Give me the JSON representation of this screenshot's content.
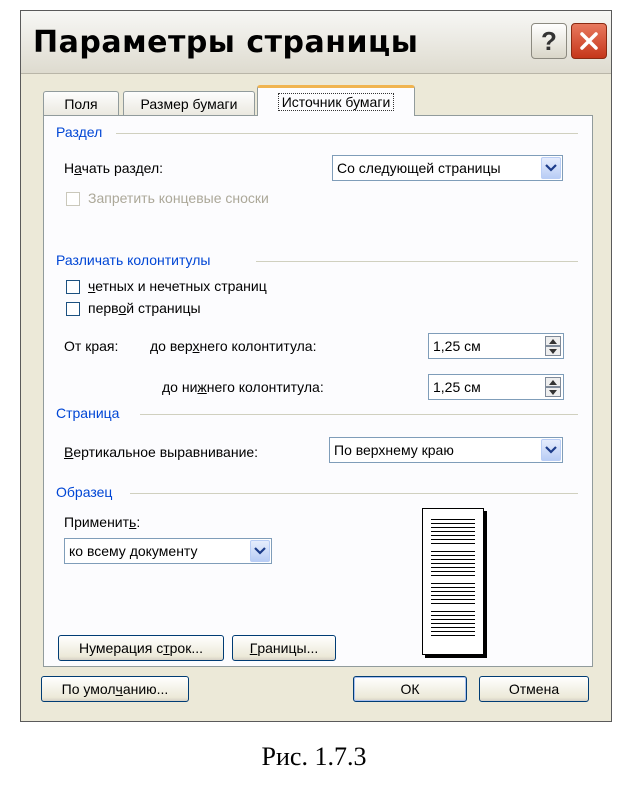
{
  "dialog": {
    "title": "Параметры страницы",
    "help_label": "?",
    "tabs": [
      {
        "label": "Поля",
        "active": false
      },
      {
        "label": "Размер бумаги",
        "active": false
      },
      {
        "label": "Источник бумаги",
        "active": true
      }
    ],
    "section": {
      "title": "Раздел",
      "start_label_pre": "Н",
      "start_label_u": "а",
      "start_label_post": "чать раздел:",
      "start_value": "Со следующей страницы",
      "suppress_endnotes_label": "Запретить концевые сноски",
      "suppress_endnotes_checked": false
    },
    "headers": {
      "title": "Различать колонтитулы",
      "odd_even_u": "ч",
      "odd_even_post": "етных и нечетных страниц",
      "odd_even_checked": false,
      "first_pre": "перв",
      "first_u": "о",
      "first_post": "й страницы",
      "first_checked": false,
      "from_edge_label": "От края:",
      "header_label_pre": "до вер",
      "header_label_u": "х",
      "header_label_post": "него колонтитула:",
      "header_value": "1,25 см",
      "footer_label_pre": "до ни",
      "footer_label_u": "ж",
      "footer_label_post": "него колонтитула:",
      "footer_value": "1,25 см"
    },
    "page": {
      "title": "Страница",
      "valign_u": "В",
      "valign_post": "ертикальное выравнивание:",
      "valign_value": "По верхнему краю"
    },
    "preview": {
      "title": "Образец",
      "apply_pre": "Применит",
      "apply_u": "ь",
      "apply_post": ":",
      "apply_value": "ко всему документу"
    },
    "buttons": {
      "line_numbers_pre": "Нумерация с",
      "line_numbers_u": "т",
      "line_numbers_post": "рок...",
      "borders_u": "Г",
      "borders_post": "раницы...",
      "default_pre": "По умол",
      "default_u": "ч",
      "default_post": "анию...",
      "ok": "ОК",
      "cancel": "Отмена"
    }
  },
  "caption": "Рис. 1.7.3"
}
